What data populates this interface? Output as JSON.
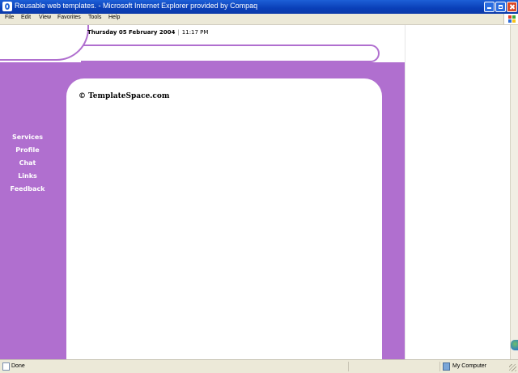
{
  "window": {
    "title": "Reusable web templates. - Microsoft Internet Explorer provided by Compaq"
  },
  "menu": {
    "items": [
      "File",
      "Edit",
      "View",
      "Favorites",
      "Tools",
      "Help"
    ]
  },
  "header": {
    "date": "Thursday 05 February 2004",
    "separator": "|",
    "time": "11:17 PM"
  },
  "nav": {
    "items": [
      "Services",
      "Profile",
      "Chat",
      "Links",
      "Feedback"
    ]
  },
  "content": {
    "copyright": "© TemplateSpace.com"
  },
  "status": {
    "left": "Done",
    "zone": "My Computer"
  },
  "colors": {
    "accent": "#b06fcf",
    "titlebar": "#0a3fb8",
    "chrome": "#ece9d8"
  },
  "icons": {
    "titlebar": "ie-icon",
    "windows": "windows-logo-icon",
    "status": "page-icon",
    "zone": "computer-icon"
  }
}
